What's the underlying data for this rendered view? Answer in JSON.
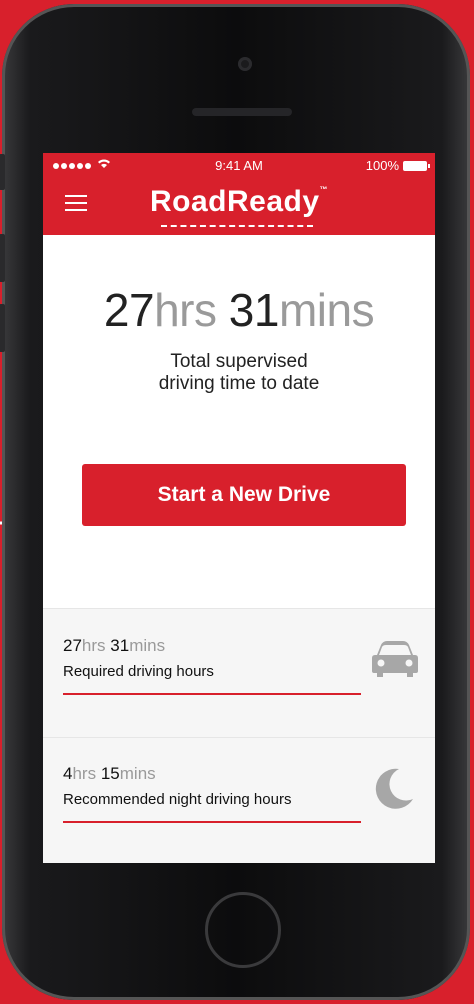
{
  "status_bar": {
    "time": "9:41 AM",
    "battery": "100%"
  },
  "header": {
    "logo_text": "RoadReady",
    "trademark": "™"
  },
  "summary": {
    "hours_value": "27",
    "hours_unit": "hrs",
    "minutes_value": "31",
    "minutes_unit": "mins",
    "caption_line1": "Total supervised",
    "caption_line2": "driving time to date"
  },
  "actions": {
    "start_drive_label": "Start a New Drive"
  },
  "stats": [
    {
      "hours_value": "27",
      "hours_unit": "hrs",
      "minutes_value": "31",
      "minutes_unit": "mins",
      "label": "Required driving hours",
      "icon": "car-icon"
    },
    {
      "hours_value": "4",
      "hours_unit": "hrs",
      "minutes_value": "15",
      "minutes_unit": "mins",
      "label": "Recommended night driving hours",
      "icon": "moon-icon"
    }
  ],
  "colors": {
    "brand_red": "#d8202c",
    "muted_gray": "#9a9a9a",
    "icon_gray": "#a7a7a7"
  }
}
